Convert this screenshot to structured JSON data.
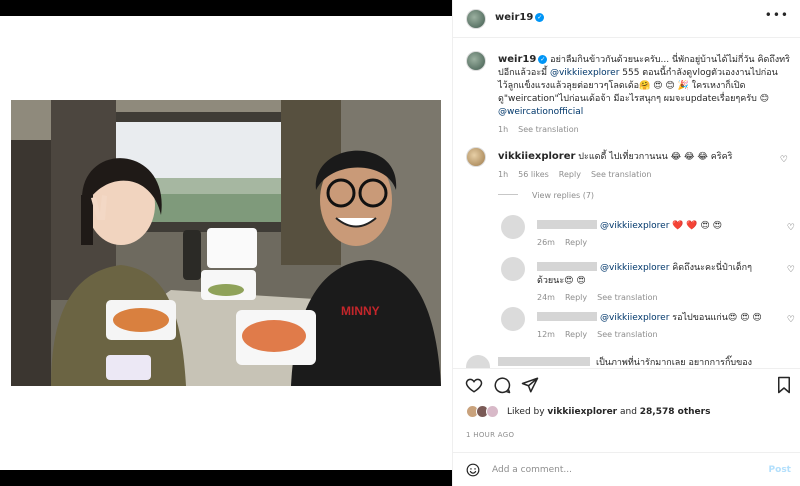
{
  "header": {
    "username": "weir19",
    "verified_icon": "verified-badge-icon",
    "more_icon": "more-options-icon",
    "more_glyph": "•••"
  },
  "caption": {
    "username": "weir19",
    "text_before": " อย่าลืมกินข้าวกันด้วยนะครับ... นี่พักอยู่บ้านได้ไม่กี่วัน คิดถึงทริปอีกแล้วอะมี้ ",
    "mention": "@vikkiiexplorer",
    "text_middle": " 555 ตอนนี้กำลังดูvlogตัวเองงานไปก่อน ไว้ลูกแข็งแรงแล้วลุยต่อยาวๆโลดเด้อ🤗 😍 😊 🎉 ใครเหงาก็เปิดดู\"weircation\"ไปก่อนเด้อจ้า มีอะไรสนุกๆ ผมจะupdateเรื่อยๆครับ 😊 ",
    "mention2": "@weircationofficial",
    "time": "1h",
    "see_translation": "See translation"
  },
  "comment1": {
    "username": "vikkiiexplorer",
    "text": " ปะแดดี้ ไปเที่ยวกานนน 😂 😂 😂 คริคริ",
    "time": "1h",
    "likes": "56 likes",
    "reply": "Reply",
    "see_translation": "See translation"
  },
  "view_replies": "View replies (7)",
  "replies": [
    {
      "mention": "@vikkiiexplorer",
      "text": " ❤️ ❤️ 😍 😍",
      "time": "26m",
      "reply": "Reply",
      "see_translation": ""
    },
    {
      "mention": "@vikkiiexplorer",
      "text": " คิดถึงนะคะนี่ป๋าเด็กๆ ด้วยนะ😍 😍",
      "time": "24m",
      "reply": "Reply",
      "see_translation": "See translation"
    },
    {
      "mention": "@vikkiiexplorer",
      "text": " รอไปขอนแก่น😍 😍 😍",
      "time": "12m",
      "reply": "Reply",
      "see_translation": "See translation"
    }
  ],
  "partial_comment": "เป็นภาพที่น่ารักมากเลย อยากการกิ๊บของ",
  "actions": {
    "like_icon": "heart-icon",
    "comment_icon": "comment-icon",
    "share_icon": "share-icon",
    "save_icon": "bookmark-icon"
  },
  "likes": {
    "prefix": "Liked by ",
    "user": "vikkiiexplorer",
    "middle": " and ",
    "count": "28,578 others"
  },
  "time_ago": "1 HOUR AGO",
  "add_comment": {
    "placeholder": "Add a comment...",
    "post_label": "Post",
    "emoji_icon": "emoji-icon"
  },
  "colors": {
    "link": "#00376b",
    "verified": "#0095f6",
    "muted": "#8e8e8e",
    "post_disabled": "#b2dffc"
  }
}
